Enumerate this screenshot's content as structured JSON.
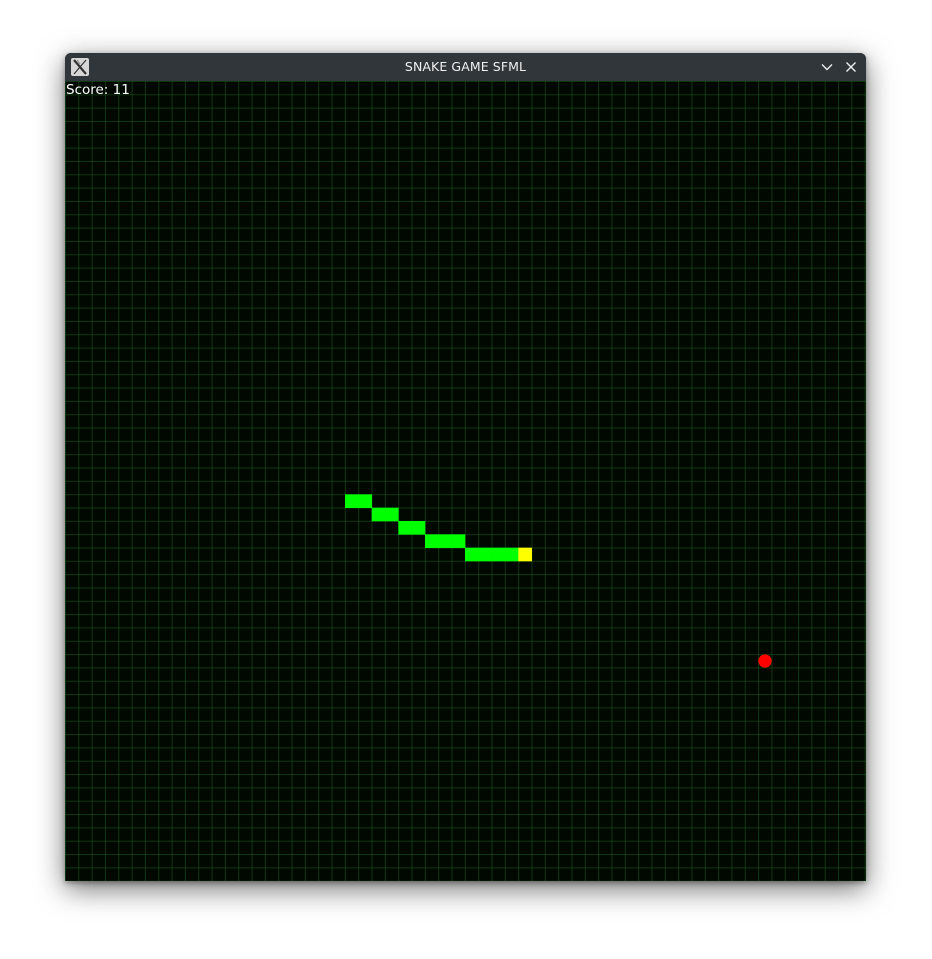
{
  "window": {
    "title": "SNAKE GAME SFML",
    "icons": {
      "app": "x-window-icon",
      "minimize": "chevron-down-icon",
      "close": "close-icon"
    }
  },
  "game": {
    "score_label": "Score:",
    "score_value": "11",
    "grid": {
      "columns": 60,
      "rows": 60
    },
    "colors": {
      "background": "#010801",
      "grid_line": "#1a5c1a",
      "snake_body": "#00ff00",
      "snake_head": "#ffff00",
      "food": "#ff0000"
    },
    "snake": {
      "head": [
        34,
        35
      ],
      "body": [
        [
          33,
          35
        ],
        [
          32,
          35
        ],
        [
          31,
          35
        ],
        [
          30,
          35
        ],
        [
          29,
          34
        ],
        [
          28,
          34
        ],
        [
          27,
          34
        ],
        [
          26,
          33
        ],
        [
          25,
          33
        ],
        [
          24,
          32
        ],
        [
          23,
          32
        ],
        [
          22,
          31
        ],
        [
          21,
          31
        ]
      ]
    },
    "food": [
      52,
      43
    ]
  }
}
